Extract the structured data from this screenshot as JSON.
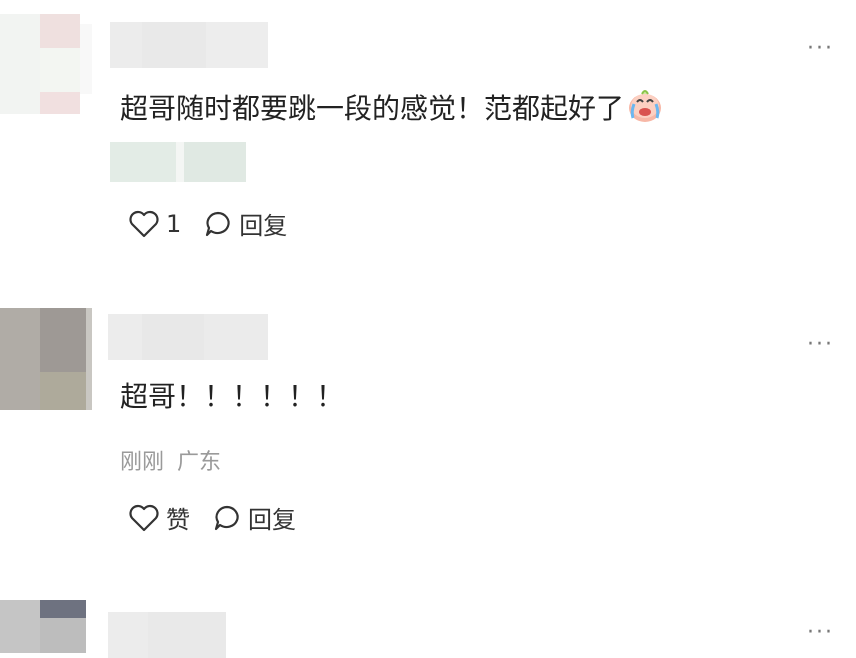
{
  "comments": [
    {
      "text": "超哥随时都要跳一段的感觉！范都起好了",
      "emoji": "crying-laughing-emoji",
      "like_count": "1",
      "reply_label": "回复",
      "more_label": "···"
    },
    {
      "text": "超哥！！！！！！",
      "time": "刚刚",
      "location": "广东",
      "like_label": "赞",
      "reply_label": "回复",
      "more_label": "···"
    },
    {
      "more_label": "···"
    }
  ],
  "colors": {
    "text": "#222222",
    "meta": "#9a9a9a",
    "icon": "#333333"
  }
}
